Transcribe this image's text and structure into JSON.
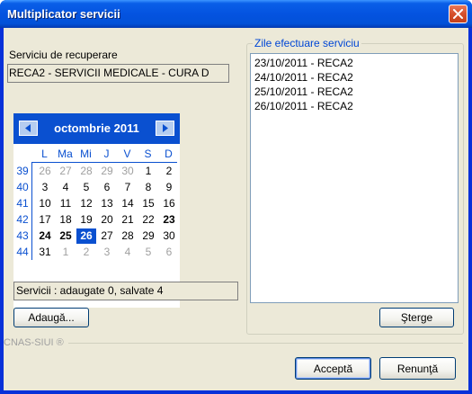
{
  "window": {
    "title": "Multiplicator servicii"
  },
  "service": {
    "label": "Serviciu de recuperare",
    "value": "RECA2 - SERVICII MEDICALE - CURA D"
  },
  "calendar": {
    "month_label": "octombrie 2011",
    "weekday_headers": [
      "L",
      "Ma",
      "Mi",
      "J",
      "V",
      "S",
      "D"
    ],
    "weeks": [
      {
        "num": "39",
        "days": [
          {
            "d": "26",
            "o": true
          },
          {
            "d": "27",
            "o": true
          },
          {
            "d": "28",
            "o": true
          },
          {
            "d": "29",
            "o": true
          },
          {
            "d": "30",
            "o": true
          },
          {
            "d": "1"
          },
          {
            "d": "2"
          }
        ]
      },
      {
        "num": "40",
        "days": [
          {
            "d": "3"
          },
          {
            "d": "4"
          },
          {
            "d": "5"
          },
          {
            "d": "6"
          },
          {
            "d": "7"
          },
          {
            "d": "8"
          },
          {
            "d": "9"
          }
        ]
      },
      {
        "num": "41",
        "days": [
          {
            "d": "10"
          },
          {
            "d": "11"
          },
          {
            "d": "12"
          },
          {
            "d": "13"
          },
          {
            "d": "14"
          },
          {
            "d": "15"
          },
          {
            "d": "16"
          }
        ]
      },
      {
        "num": "42",
        "days": [
          {
            "d": "17"
          },
          {
            "d": "18"
          },
          {
            "d": "19"
          },
          {
            "d": "20"
          },
          {
            "d": "21"
          },
          {
            "d": "22"
          },
          {
            "d": "23",
            "b": true
          }
        ]
      },
      {
        "num": "43",
        "days": [
          {
            "d": "24",
            "b": true
          },
          {
            "d": "25",
            "b": true
          },
          {
            "d": "26",
            "s": true
          },
          {
            "d": "27"
          },
          {
            "d": "28"
          },
          {
            "d": "29"
          },
          {
            "d": "30"
          }
        ]
      },
      {
        "num": "44",
        "days": [
          {
            "d": "31"
          },
          {
            "d": "1",
            "o": true
          },
          {
            "d": "2",
            "o": true
          },
          {
            "d": "3",
            "o": true
          },
          {
            "d": "4",
            "o": true
          },
          {
            "d": "5",
            "o": true
          },
          {
            "d": "6",
            "o": true
          }
        ]
      }
    ]
  },
  "status": {
    "text": "Servicii : adaugate 0, salvate 4"
  },
  "buttons": {
    "add": "Adaugă...",
    "delete": "Şterge",
    "accept": "Acceptă",
    "cancel": "Renunţă"
  },
  "dates_group": {
    "title": "Zile efectuare serviciu",
    "items": [
      "23/10/2011 - RECA2",
      "24/10/2011 - RECA2",
      "25/10/2011 - RECA2",
      "26/10/2011 - RECA2"
    ]
  },
  "footer": {
    "label": "CNAS-SIUI ®"
  },
  "colors": {
    "title_bar": "#0453e0",
    "calendar_accent": "#0a50d0",
    "group_title": "#0046d5"
  }
}
